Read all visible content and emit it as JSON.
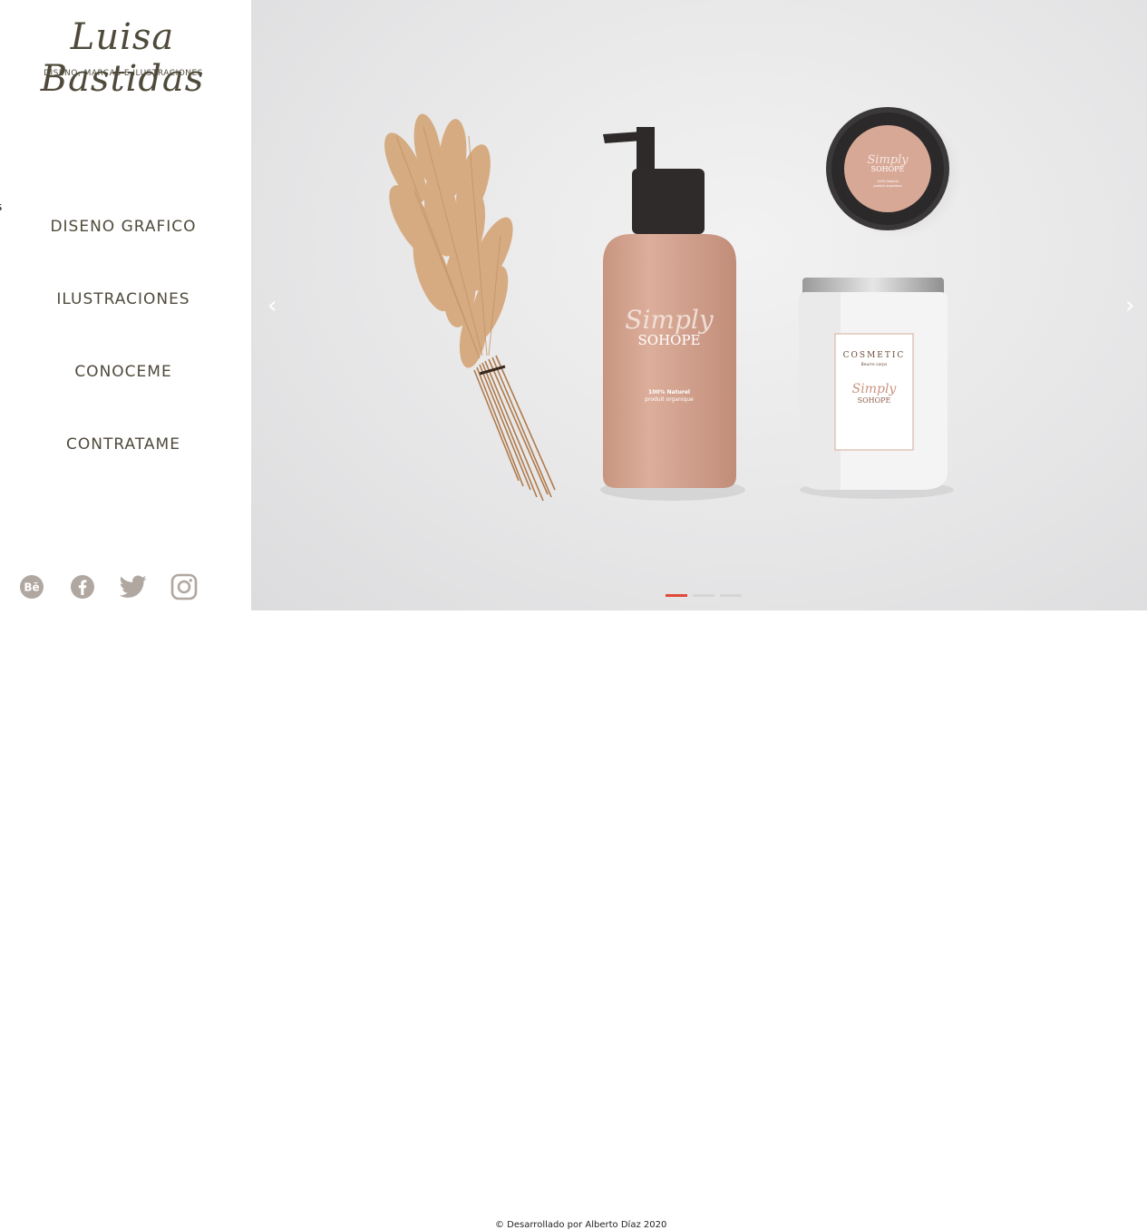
{
  "brand": {
    "name": "Luisa Bastidas",
    "tagline": "DISENO, MARCAS E ILUSTRACIONES",
    "edge_text": "s"
  },
  "nav": {
    "items": [
      {
        "label": "DISENO GRAFICO"
      },
      {
        "label": "ILUSTRACIONES"
      },
      {
        "label": "CONOCEME"
      },
      {
        "label": "CONTRATAME"
      }
    ]
  },
  "social": [
    {
      "icon": "behance-icon",
      "text": "Bē"
    },
    {
      "icon": "facebook-icon"
    },
    {
      "icon": "twitter-icon"
    },
    {
      "icon": "instagram-icon"
    }
  ],
  "carousel": {
    "prev": "‹",
    "next": "›",
    "active_slide": 1,
    "slide_count": 3,
    "products": {
      "bottle": {
        "brand_script": "Simply",
        "brand_name": "SOHOPE",
        "line1": "100% Naturel",
        "line2": "produit organique"
      },
      "round_jar": {
        "brand_script": "Simply",
        "brand_name": "SOHOPE",
        "line1": "100% Naturel",
        "line2": "produit organique"
      },
      "white_jar": {
        "title": "COSMETIC",
        "subtitle": "Beurre corps",
        "brand_script": "Simply",
        "brand_name": "SOHOPE"
      }
    }
  },
  "footer": {
    "credit": "© Desarrollado por Alberto Díaz 2020"
  },
  "colors": {
    "brand_text": "#4f4a3b",
    "social_icon": "#b0a7a0",
    "indicator_active": "#e04a3c",
    "product_pink": "#d8a897"
  }
}
